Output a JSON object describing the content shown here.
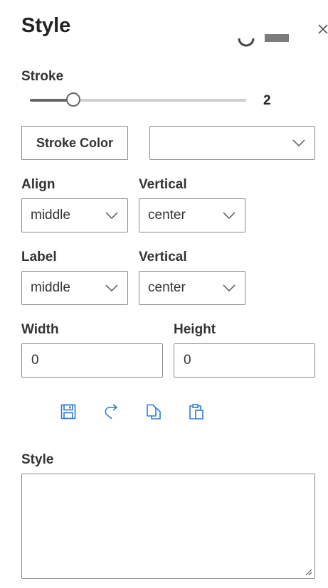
{
  "panel": {
    "title": "Style"
  },
  "stroke": {
    "label": "Stroke",
    "value": "2",
    "fraction": 0.2
  },
  "stroke_color": {
    "button_label": "Stroke Color",
    "select_value": ""
  },
  "align": {
    "label": "Align",
    "value": "middle",
    "vertical_label": "Vertical",
    "vertical_value": "center"
  },
  "label_pos": {
    "label": "Label",
    "value": "middle",
    "vertical_label": "Vertical",
    "vertical_value": "center"
  },
  "size": {
    "width_label": "Width",
    "width_value": "0",
    "height_label": "Height",
    "height_value": "0"
  },
  "toolbar": {
    "icons": [
      "save-icon",
      "redo-icon",
      "copy-icon",
      "paste-icon"
    ]
  },
  "style_field": {
    "label": "Style",
    "value": ""
  },
  "colors": {
    "accent": "#2b7cd3",
    "border": "#8a8a8a",
    "text": "#333333"
  }
}
